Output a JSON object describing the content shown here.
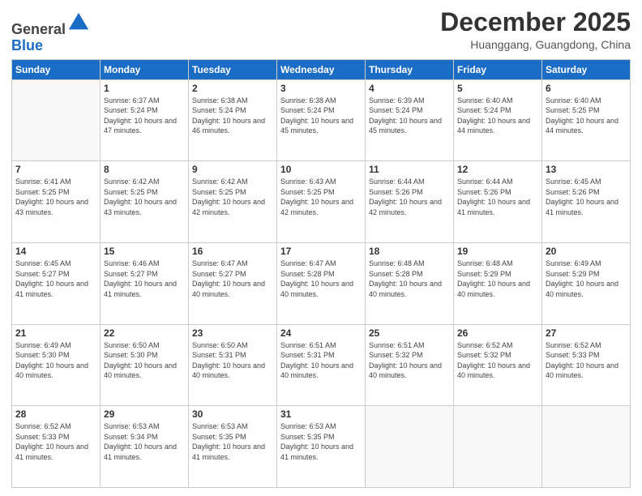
{
  "header": {
    "logo_general": "General",
    "logo_blue": "Blue",
    "month_year": "December 2025",
    "location": "Huanggang, Guangdong, China"
  },
  "weekdays": [
    "Sunday",
    "Monday",
    "Tuesday",
    "Wednesday",
    "Thursday",
    "Friday",
    "Saturday"
  ],
  "weeks": [
    [
      {
        "day": "",
        "sunrise": "",
        "sunset": "",
        "daylight": ""
      },
      {
        "day": "1",
        "sunrise": "Sunrise: 6:37 AM",
        "sunset": "Sunset: 5:24 PM",
        "daylight": "Daylight: 10 hours and 47 minutes."
      },
      {
        "day": "2",
        "sunrise": "Sunrise: 6:38 AM",
        "sunset": "Sunset: 5:24 PM",
        "daylight": "Daylight: 10 hours and 46 minutes."
      },
      {
        "day": "3",
        "sunrise": "Sunrise: 6:38 AM",
        "sunset": "Sunset: 5:24 PM",
        "daylight": "Daylight: 10 hours and 45 minutes."
      },
      {
        "day": "4",
        "sunrise": "Sunrise: 6:39 AM",
        "sunset": "Sunset: 5:24 PM",
        "daylight": "Daylight: 10 hours and 45 minutes."
      },
      {
        "day": "5",
        "sunrise": "Sunrise: 6:40 AM",
        "sunset": "Sunset: 5:24 PM",
        "daylight": "Daylight: 10 hours and 44 minutes."
      },
      {
        "day": "6",
        "sunrise": "Sunrise: 6:40 AM",
        "sunset": "Sunset: 5:25 PM",
        "daylight": "Daylight: 10 hours and 44 minutes."
      }
    ],
    [
      {
        "day": "7",
        "sunrise": "Sunrise: 6:41 AM",
        "sunset": "Sunset: 5:25 PM",
        "daylight": "Daylight: 10 hours and 43 minutes."
      },
      {
        "day": "8",
        "sunrise": "Sunrise: 6:42 AM",
        "sunset": "Sunset: 5:25 PM",
        "daylight": "Daylight: 10 hours and 43 minutes."
      },
      {
        "day": "9",
        "sunrise": "Sunrise: 6:42 AM",
        "sunset": "Sunset: 5:25 PM",
        "daylight": "Daylight: 10 hours and 42 minutes."
      },
      {
        "day": "10",
        "sunrise": "Sunrise: 6:43 AM",
        "sunset": "Sunset: 5:25 PM",
        "daylight": "Daylight: 10 hours and 42 minutes."
      },
      {
        "day": "11",
        "sunrise": "Sunrise: 6:44 AM",
        "sunset": "Sunset: 5:26 PM",
        "daylight": "Daylight: 10 hours and 42 minutes."
      },
      {
        "day": "12",
        "sunrise": "Sunrise: 6:44 AM",
        "sunset": "Sunset: 5:26 PM",
        "daylight": "Daylight: 10 hours and 41 minutes."
      },
      {
        "day": "13",
        "sunrise": "Sunrise: 6:45 AM",
        "sunset": "Sunset: 5:26 PM",
        "daylight": "Daylight: 10 hours and 41 minutes."
      }
    ],
    [
      {
        "day": "14",
        "sunrise": "Sunrise: 6:45 AM",
        "sunset": "Sunset: 5:27 PM",
        "daylight": "Daylight: 10 hours and 41 minutes."
      },
      {
        "day": "15",
        "sunrise": "Sunrise: 6:46 AM",
        "sunset": "Sunset: 5:27 PM",
        "daylight": "Daylight: 10 hours and 41 minutes."
      },
      {
        "day": "16",
        "sunrise": "Sunrise: 6:47 AM",
        "sunset": "Sunset: 5:27 PM",
        "daylight": "Daylight: 10 hours and 40 minutes."
      },
      {
        "day": "17",
        "sunrise": "Sunrise: 6:47 AM",
        "sunset": "Sunset: 5:28 PM",
        "daylight": "Daylight: 10 hours and 40 minutes."
      },
      {
        "day": "18",
        "sunrise": "Sunrise: 6:48 AM",
        "sunset": "Sunset: 5:28 PM",
        "daylight": "Daylight: 10 hours and 40 minutes."
      },
      {
        "day": "19",
        "sunrise": "Sunrise: 6:48 AM",
        "sunset": "Sunset: 5:29 PM",
        "daylight": "Daylight: 10 hours and 40 minutes."
      },
      {
        "day": "20",
        "sunrise": "Sunrise: 6:49 AM",
        "sunset": "Sunset: 5:29 PM",
        "daylight": "Daylight: 10 hours and 40 minutes."
      }
    ],
    [
      {
        "day": "21",
        "sunrise": "Sunrise: 6:49 AM",
        "sunset": "Sunset: 5:30 PM",
        "daylight": "Daylight: 10 hours and 40 minutes."
      },
      {
        "day": "22",
        "sunrise": "Sunrise: 6:50 AM",
        "sunset": "Sunset: 5:30 PM",
        "daylight": "Daylight: 10 hours and 40 minutes."
      },
      {
        "day": "23",
        "sunrise": "Sunrise: 6:50 AM",
        "sunset": "Sunset: 5:31 PM",
        "daylight": "Daylight: 10 hours and 40 minutes."
      },
      {
        "day": "24",
        "sunrise": "Sunrise: 6:51 AM",
        "sunset": "Sunset: 5:31 PM",
        "daylight": "Daylight: 10 hours and 40 minutes."
      },
      {
        "day": "25",
        "sunrise": "Sunrise: 6:51 AM",
        "sunset": "Sunset: 5:32 PM",
        "daylight": "Daylight: 10 hours and 40 minutes."
      },
      {
        "day": "26",
        "sunrise": "Sunrise: 6:52 AM",
        "sunset": "Sunset: 5:32 PM",
        "daylight": "Daylight: 10 hours and 40 minutes."
      },
      {
        "day": "27",
        "sunrise": "Sunrise: 6:52 AM",
        "sunset": "Sunset: 5:33 PM",
        "daylight": "Daylight: 10 hours and 40 minutes."
      }
    ],
    [
      {
        "day": "28",
        "sunrise": "Sunrise: 6:52 AM",
        "sunset": "Sunset: 5:33 PM",
        "daylight": "Daylight: 10 hours and 41 minutes."
      },
      {
        "day": "29",
        "sunrise": "Sunrise: 6:53 AM",
        "sunset": "Sunset: 5:34 PM",
        "daylight": "Daylight: 10 hours and 41 minutes."
      },
      {
        "day": "30",
        "sunrise": "Sunrise: 6:53 AM",
        "sunset": "Sunset: 5:35 PM",
        "daylight": "Daylight: 10 hours and 41 minutes."
      },
      {
        "day": "31",
        "sunrise": "Sunrise: 6:53 AM",
        "sunset": "Sunset: 5:35 PM",
        "daylight": "Daylight: 10 hours and 41 minutes."
      },
      {
        "day": "",
        "sunrise": "",
        "sunset": "",
        "daylight": ""
      },
      {
        "day": "",
        "sunrise": "",
        "sunset": "",
        "daylight": ""
      },
      {
        "day": "",
        "sunrise": "",
        "sunset": "",
        "daylight": ""
      }
    ]
  ]
}
